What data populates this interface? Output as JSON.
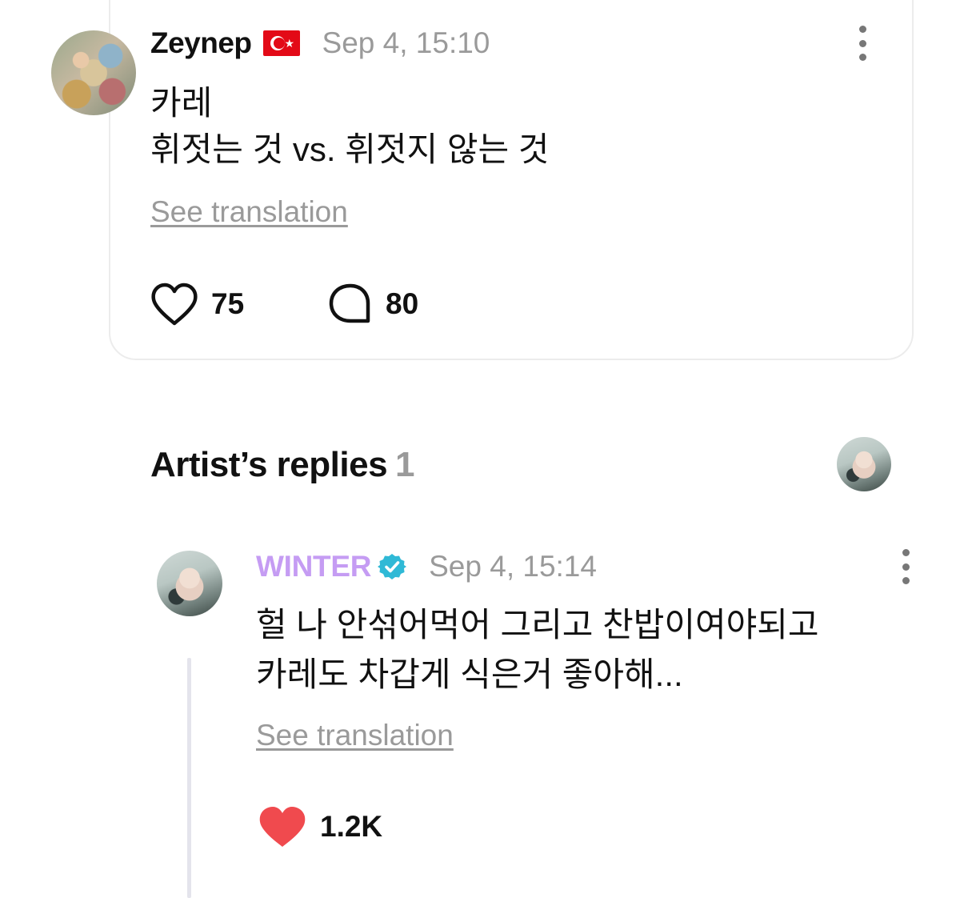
{
  "post": {
    "author": "Zeynep",
    "flag_icon": "turkey-flag-icon",
    "timestamp": "Sep 4, 15:10",
    "text": "카레\n휘젓는 것 vs. 휘젓지 않는 것",
    "see_translation": "See translation",
    "likes": "75",
    "comments": "80"
  },
  "artist_replies": {
    "title": "Artist’s replies",
    "count": "1"
  },
  "reply": {
    "author": "WINTER",
    "timestamp": "Sep 4, 15:14",
    "text": "헐 나 안섞어먹어 그리고 찬밥이여야되고\n카레도 차갑게 식은거 좋아해...",
    "see_translation": "See translation",
    "likes": "1.2K"
  },
  "colors": {
    "artist_name": "#c59cf3",
    "verified_badge": "#2fb9d6",
    "liked_heart": "#f04a4e",
    "muted_text": "#9a9a9a"
  }
}
